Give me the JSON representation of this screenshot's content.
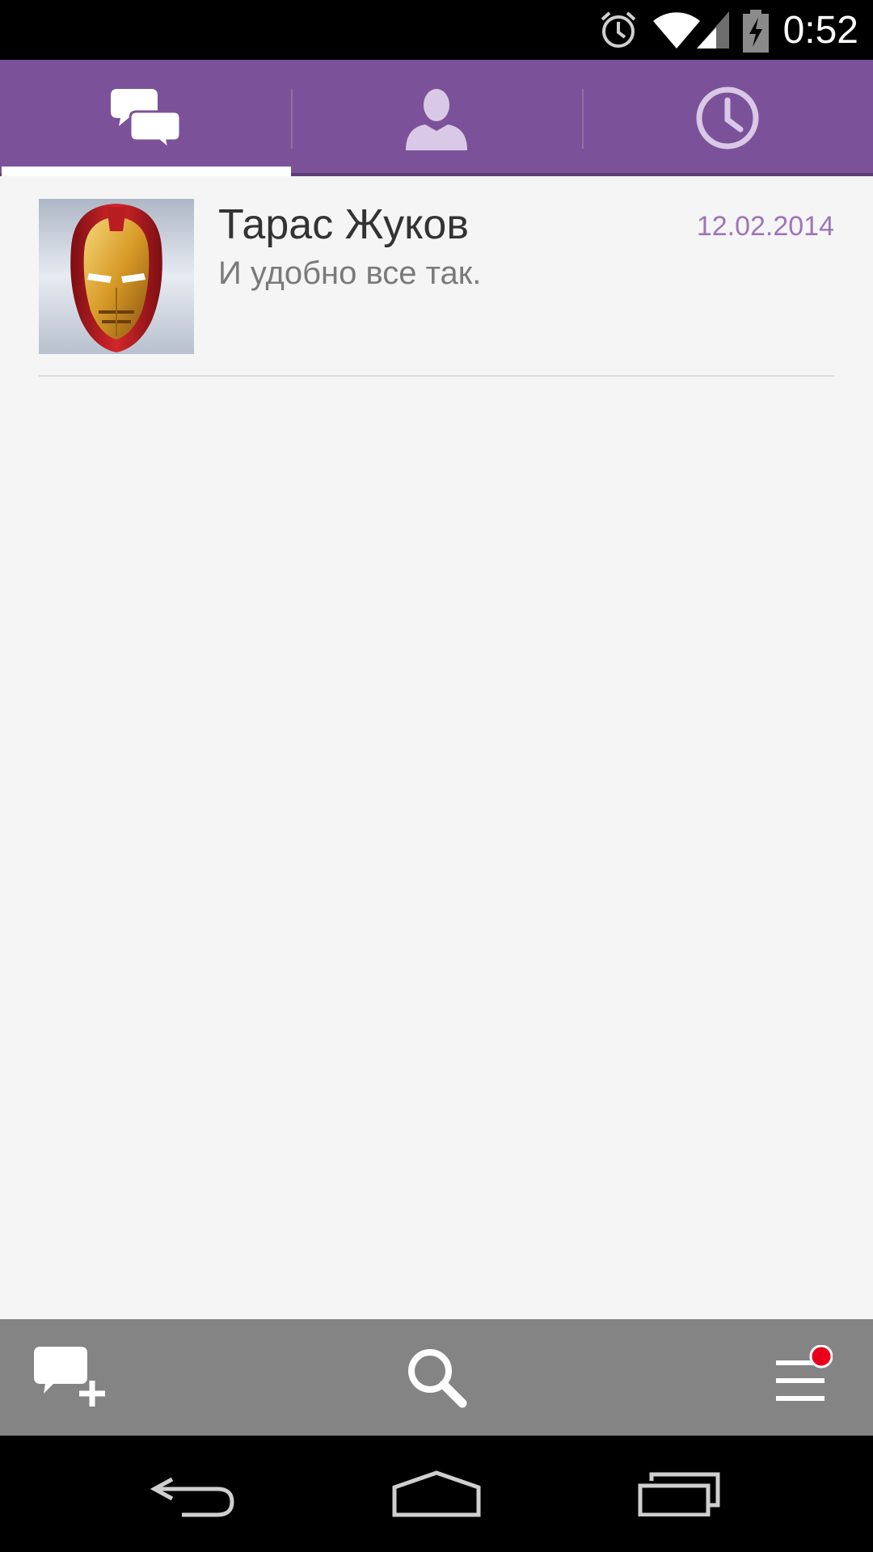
{
  "status_bar": {
    "time": "0:52",
    "icons": [
      "alarm-icon",
      "wifi-icon",
      "signal-icon",
      "battery-icon"
    ]
  },
  "tabs": [
    {
      "name": "chats",
      "icon": "chat-bubbles-icon",
      "selected": true
    },
    {
      "name": "contacts",
      "icon": "person-icon",
      "selected": false
    },
    {
      "name": "recents",
      "icon": "clock-icon",
      "selected": false
    }
  ],
  "conversations": [
    {
      "name": "Тарас Жуков",
      "date": "12.02.2014",
      "preview": "И удобно все так.",
      "avatar": "iron-man-mask-avatar"
    }
  ],
  "action_bar": {
    "buttons": [
      "new-message-icon",
      "search-icon",
      "menu-icon"
    ],
    "menu_has_notification": true
  },
  "nav_bar": {
    "buttons": [
      "back-icon",
      "home-icon",
      "recent-apps-icon"
    ]
  },
  "colors": {
    "accent": "#7b5299",
    "date": "#9d76b8",
    "notification": "#e8001c"
  }
}
